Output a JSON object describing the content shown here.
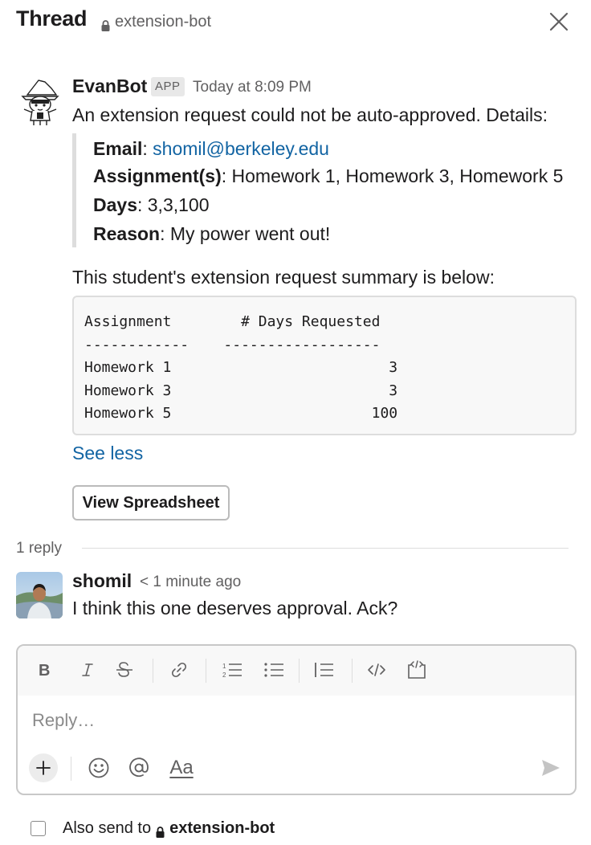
{
  "header": {
    "title": "Thread",
    "channel": "extension-bot"
  },
  "bot_message": {
    "sender": "EvanBot",
    "badge": "APP",
    "timestamp": "Today at 8:09 PM",
    "intro": "An extension request could not be auto-approved. Details:",
    "details": {
      "email_label": "Email",
      "email_value": "shomil@berkeley.edu",
      "assignments_label": "Assignment(s)",
      "assignments_value": "Homework 1, Homework 3, Homework 5",
      "days_label": "Days",
      "days_value": "3,3,100",
      "reason_label": "Reason",
      "reason_value": "My power went out!"
    },
    "summary_intro": "This student's extension request summary is below:",
    "summary_table": {
      "headers": [
        "Assignment",
        "# Days Requested"
      ],
      "rows": [
        [
          "Homework 1",
          "3"
        ],
        [
          "Homework 3",
          "3"
        ],
        [
          "Homework 5",
          "100"
        ]
      ]
    },
    "see_less": "See less",
    "button_label": "View Spreadsheet"
  },
  "replies": {
    "count_label": "1 reply",
    "items": [
      {
        "sender": "shomil",
        "timestamp": "< 1 minute ago",
        "text": "I think this one deserves approval. Ack?"
      }
    ]
  },
  "composer": {
    "placeholder": "Reply…",
    "toolbar_icons": [
      "bold-icon",
      "italic-icon",
      "strikethrough-icon",
      "link-icon",
      "ordered-list-icon",
      "bulleted-list-icon",
      "blockquote-icon",
      "code-icon",
      "code-block-icon"
    ],
    "bottom_icons": [
      "plus-icon",
      "emoji-icon",
      "mention-icon",
      "formatting-icon",
      "send-icon"
    ],
    "formatting_label": "Aa"
  },
  "also_send": {
    "label": "Also send to",
    "channel": "extension-bot"
  },
  "colors": {
    "link": "#1264a3",
    "muted": "#616061",
    "quote_bar": "#dddddd"
  }
}
